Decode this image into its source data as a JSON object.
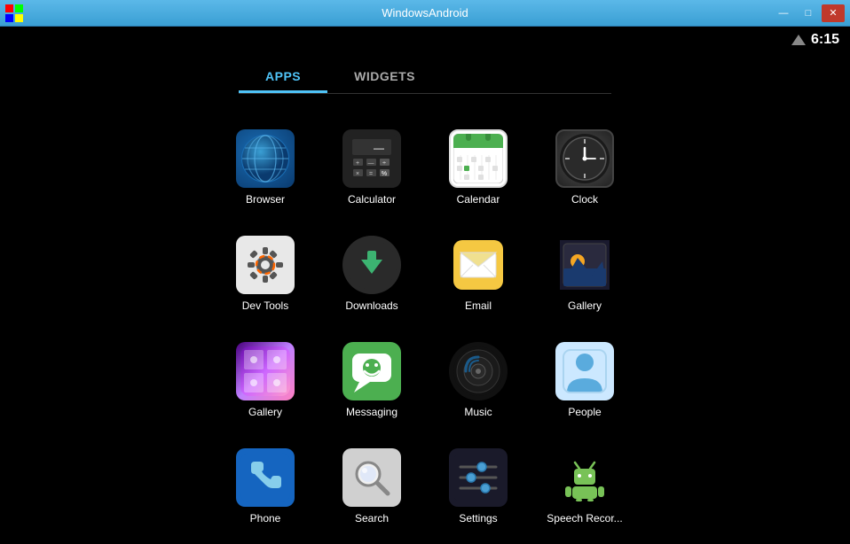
{
  "titlebar": {
    "title": "WindowsAndroid",
    "minimize_label": "—",
    "restore_label": "□",
    "close_label": "✕"
  },
  "status": {
    "time": "6:15"
  },
  "tabs": [
    {
      "id": "apps",
      "label": "APPS",
      "active": true
    },
    {
      "id": "widgets",
      "label": "WIDGETS",
      "active": false
    }
  ],
  "apps": [
    {
      "id": "browser",
      "label": "Browser"
    },
    {
      "id": "calculator",
      "label": "Calculator"
    },
    {
      "id": "calendar",
      "label": "Calendar"
    },
    {
      "id": "clock",
      "label": "Clock"
    },
    {
      "id": "devtools",
      "label": "Dev Tools"
    },
    {
      "id": "downloads",
      "label": "Downloads"
    },
    {
      "id": "email",
      "label": "Email"
    },
    {
      "id": "gallery1",
      "label": "Gallery"
    },
    {
      "id": "gallery2",
      "label": "Gallery"
    },
    {
      "id": "messaging",
      "label": "Messaging"
    },
    {
      "id": "music",
      "label": "Music"
    },
    {
      "id": "people",
      "label": "People"
    },
    {
      "id": "phone",
      "label": "Phone"
    },
    {
      "id": "search",
      "label": "Search"
    },
    {
      "id": "settings",
      "label": "Settings"
    },
    {
      "id": "speech",
      "label": "Speech Recor..."
    }
  ]
}
